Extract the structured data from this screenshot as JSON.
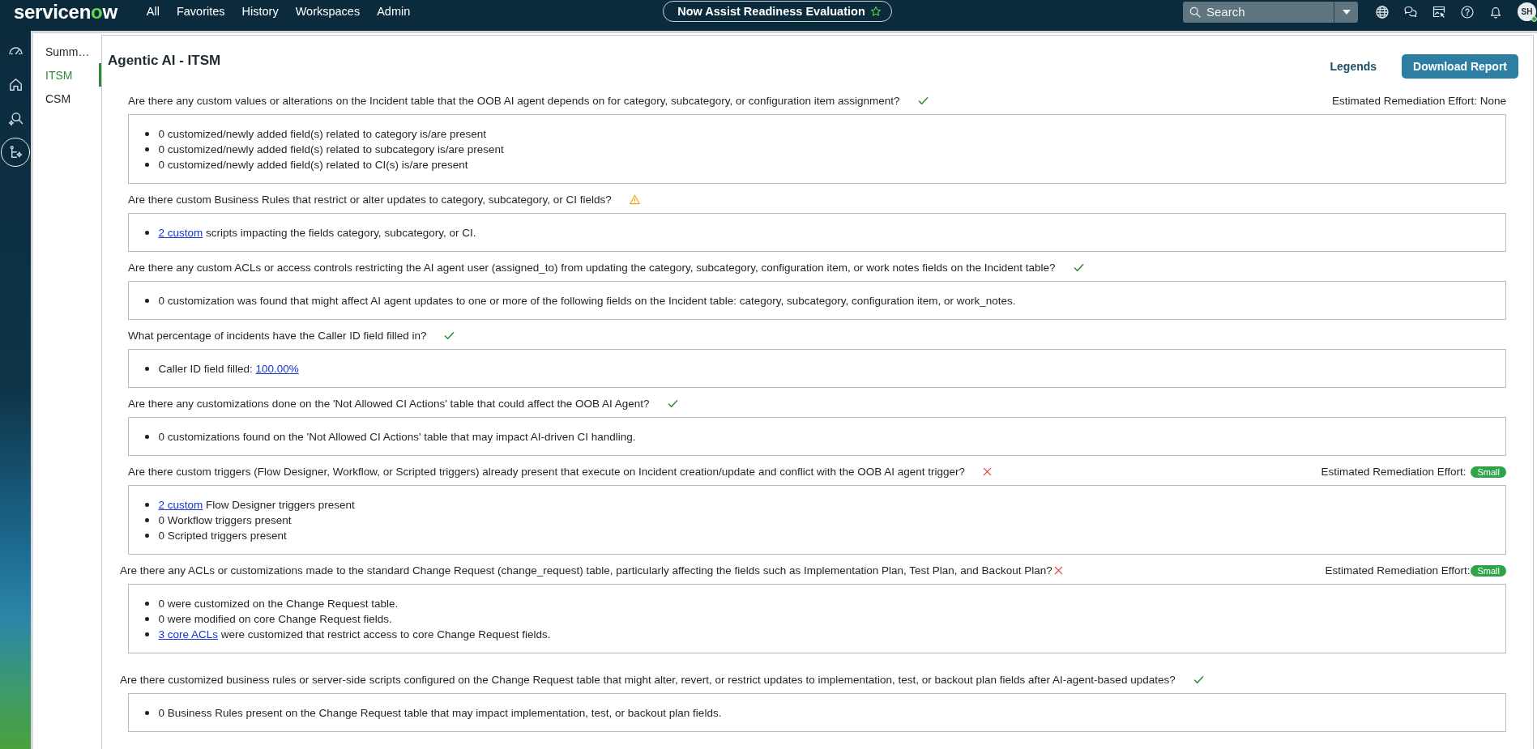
{
  "top_bar": {
    "logo": "servicenow",
    "menu": [
      {
        "label": "All",
        "selected": false
      },
      {
        "label": "Favorites",
        "selected": false
      },
      {
        "label": "History",
        "selected": false
      },
      {
        "label": "Workspaces",
        "selected": false
      },
      {
        "label": "Admin",
        "selected": false
      }
    ],
    "page_title": {
      "text": "Now Assist Readiness Evaluation",
      "favorite": false
    },
    "search": {
      "placeholder": "Search"
    },
    "user": {
      "initials": "SH",
      "online": true
    }
  },
  "rail": [
    {
      "selected": false
    },
    {
      "selected": false
    },
    {
      "selected": false
    },
    {
      "selected": true
    }
  ],
  "nav": [
    {
      "label": "Summ…",
      "selected": false
    },
    {
      "label": "ITSM",
      "selected": true
    },
    {
      "label": "CSM",
      "selected": false
    }
  ],
  "panel": {
    "title": "Agentic AI - ITSM",
    "legends": "Legends",
    "download": "Download Report",
    "questions": [
      {
        "kind": "indented",
        "text": "Are there any custom values or alterations on the Incident table that the OOB AI agent depends on for category, subcategory, or configuration item assignment?",
        "status": {
          "kind": "pass"
        },
        "effort": {
          "label": "Estimated Remediation Effort: None"
        },
        "findings": [
          {
            "text": "0 customized/newly added field(s) related to category is/are present"
          },
          {
            "text": "0 customized/newly added field(s) related to subcategory is/are present"
          },
          {
            "text": "0 customized/newly added field(s) related to CI(s) is/are present"
          }
        ]
      },
      {
        "kind": "indented",
        "text": "Are there custom Business Rules that restrict or alter updates to category, subcategory, or CI fields?",
        "status": {
          "kind": "warning"
        },
        "findings": [
          {
            "link": "2 custom",
            "after": "scripts impacting the fields category, subcategory, or CI."
          }
        ]
      },
      {
        "kind": "indented",
        "text": "Are there any custom ACLs or access controls restricting the AI agent user (assigned_to) from updating the category, subcategory, configuration item, or work notes fields on the Incident table?",
        "status": {
          "kind": "pass"
        },
        "findings": [
          {
            "text": "0 customization was found that might affect AI agent updates to one or more of the following fields on the Incident table: category, subcategory, configuration item, or work_notes."
          }
        ]
      },
      {
        "kind": "indented",
        "text": "What percentage of incidents have the Caller ID field filled in?",
        "status": {
          "kind": "pass"
        },
        "findings": [
          {
            "text": "Caller ID field filled:",
            "link": "100.00%"
          }
        ]
      },
      {
        "kind": "indented",
        "text": "Are there any customizations done on the 'Not Allowed CI Actions' table that could affect the OOB AI Agent?",
        "status": {
          "kind": "pass"
        },
        "findings": [
          {
            "text": "0 customizations found on the 'Not Allowed CI Actions' table that may impact AI-driven CI handling."
          }
        ]
      },
      {
        "kind": "indented",
        "text": "Are there custom triggers (Flow Designer, Workflow, or Scripted triggers) already present that execute on Incident creation/update and conflict with the OOB AI agent trigger?",
        "status": {
          "kind": "fail"
        },
        "effort": {
          "label": "Estimated Remediation Effort:",
          "badge": "Small"
        },
        "findings": [
          {
            "link": "2 custom",
            "after": "Flow Designer triggers present"
          },
          {
            "text": "0 Workflow triggers present"
          },
          {
            "text": "0 Scripted triggers present"
          }
        ]
      },
      {
        "kind": "compact",
        "text": "Are there any ACLs or customizations made to the standard Change Request (change_request) table, particularly affecting the fields such as Implementation Plan, Test Plan, and Backout Plan?",
        "status": {
          "kind": "fail"
        },
        "effort": {
          "label": "Estimated Remediation Effort:",
          "badge": "Small"
        },
        "findings": [
          {
            "text": "0 were customized on the Change Request table."
          },
          {
            "text": "0 were modified on core Change Request fields."
          },
          {
            "link": "3 core ACLs",
            "after": "were customized that restrict access to core Change Request fields."
          }
        ]
      },
      {
        "kind": "flush",
        "text": "Are there customized business rules or server-side scripts configured on the Change Request table that might alter, revert, or restrict updates to implementation, test, or backout plan fields after AI-agent-based updates?",
        "status": {
          "kind": "pass"
        },
        "findings": [
          {
            "text": "0 Business Rules present on the Change Request table that may impact implementation, test, or backout plan fields."
          }
        ]
      }
    ]
  }
}
